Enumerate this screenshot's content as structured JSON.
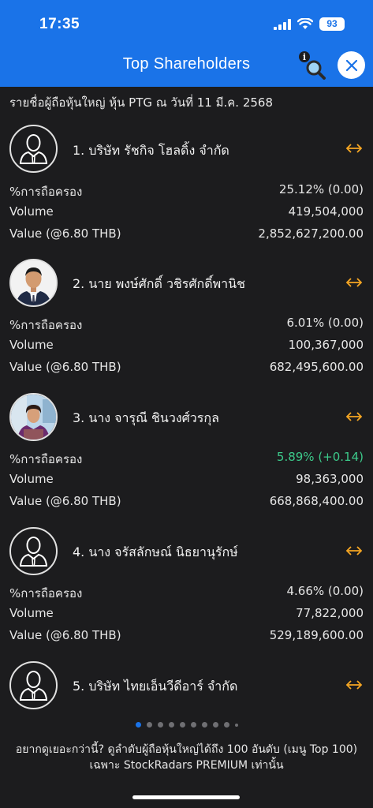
{
  "status": {
    "time": "17:35",
    "battery": "93"
  },
  "header": {
    "title": "Top Shareholders"
  },
  "subtitle": "รายชื่อผู้ถือหุ้นใหญ่ หุ้น PTG ณ วันที่ 11 มี.ค. 2568",
  "labels": {
    "holding": "%การถือครอง",
    "volume": "Volume",
    "value": "Value (@6.80 THB)"
  },
  "shareholders": [
    {
      "name": "1. บริษัท  รัชกิจ โฮลดิ้ง จำกัด",
      "holding": "25.12% (0.00)",
      "volume": "419,504,000",
      "value": "2,852,627,200.00",
      "avatar": "placeholder-person-icon"
    },
    {
      "name": "2. นาย พงษ์ศักดิ์ วชิรศักดิ์พานิช",
      "holding": "6.01% (0.00)",
      "volume": "100,367,000",
      "value": "682,495,600.00",
      "avatar": "photo"
    },
    {
      "name": "3. นาง จารุณี ชินวงศ์วรกุล",
      "holding": "5.89% (+0.14)",
      "holding_change": "up",
      "volume": "98,363,000",
      "value": "668,868,400.00",
      "avatar": "photo"
    },
    {
      "name": "4. นาง จรัสลักษณ์ นิธยานุรักษ์",
      "holding": "4.66% (0.00)",
      "volume": "77,822,000",
      "value": "529,189,600.00",
      "avatar": "placeholder-person-icon"
    },
    {
      "name": "5. บริษัท  ไทยเอ็นวีดีอาร์ จำกัด",
      "avatar": "placeholder-person-icon"
    }
  ],
  "pagination": {
    "pages": 10,
    "active": 1
  },
  "footer": {
    "line1": "อยากดูเยอะกว่านี้? ดูลำดับผู้ถือหุ้นใหญ่ได้ถึง 100 อันดับ (เมนู Top 100)",
    "line2": "เฉพาะ StockRadars PREMIUM เท่านั้น"
  },
  "colors": {
    "header": "#1a73e8",
    "background": "#1c1c1e",
    "positive": "#3cc98a",
    "expand": "#f5a623"
  }
}
